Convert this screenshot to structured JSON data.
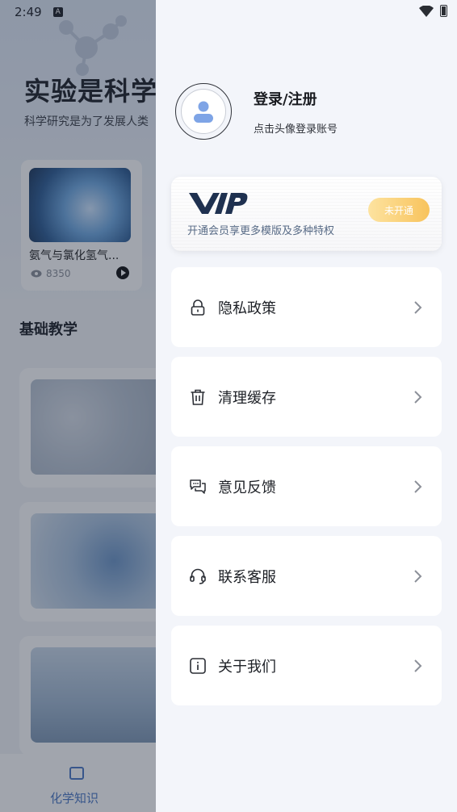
{
  "status_bar": {
    "time": "2:49",
    "notification_glyph": "A"
  },
  "background": {
    "title": "实验是科学",
    "subtitle": "科学研究是为了发展人类",
    "featured_card": {
      "title": "氨气与氯化氢气...",
      "views": "8350"
    },
    "section_title": "基础教学",
    "bottom_nav": {
      "label": "化学知识",
      "icon": "book-icon"
    }
  },
  "drawer": {
    "profile": {
      "title": "登录/注册",
      "subtitle": "点击头像登录账号",
      "icon": "user-icon"
    },
    "vip": {
      "logo": "VIP",
      "description": "开通会员享更多模版及多种特权",
      "button_label": "未开通"
    },
    "menu": [
      {
        "label": "隐私政策",
        "icon": "lock-icon"
      },
      {
        "label": "清理缓存",
        "icon": "trash-icon"
      },
      {
        "label": "意见反馈",
        "icon": "chat-icon"
      },
      {
        "label": "联系客服",
        "icon": "headset-icon"
      },
      {
        "label": "关于我们",
        "icon": "info-icon"
      }
    ]
  },
  "colors": {
    "drawer_bg": "#f3f5fa",
    "vip_button": "#f8c35c",
    "vip_text": "#586b86",
    "accent": "#4a78c4"
  }
}
